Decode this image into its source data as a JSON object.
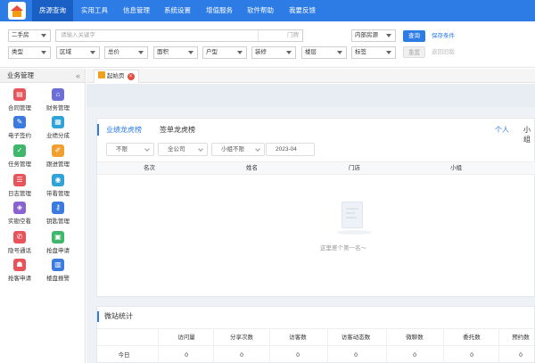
{
  "nav": {
    "items": [
      "房源查询",
      "实用工具",
      "信息管理",
      "系统设置",
      "增值服务",
      "软件帮助",
      "我要反馈"
    ],
    "active_index": 0
  },
  "search": {
    "type_select": "二手房",
    "keyword_placeholder": "请输入关键字",
    "store_label": "门牌",
    "scope_select": "内部房源",
    "query_button": "查询",
    "save_condition": "保存条件",
    "reset_button": "重置",
    "return_old": "返回旧版",
    "filters": [
      "类型",
      "区域",
      "总价",
      "面积",
      "户型",
      "装修",
      "楼层",
      "标签"
    ]
  },
  "sidebar": {
    "title": "业务管理",
    "collapse_icon": "double-chevron-left-icon",
    "items": [
      {
        "label": "合同管理",
        "icon": "contract-icon",
        "color": "#e9545a"
      },
      {
        "label": "财务管理",
        "icon": "finance-house-icon",
        "color": "#6b6fd6"
      },
      {
        "label": "电子签约",
        "icon": "e-sign-icon",
        "color": "#3b7be0"
      },
      {
        "label": "业绩分成",
        "icon": "performance-icon",
        "color": "#2fa3d7"
      },
      {
        "label": "任务管理",
        "icon": "task-icon",
        "color": "#3fb86b"
      },
      {
        "label": "跟进管理",
        "icon": "follow-icon",
        "color": "#f0a030"
      },
      {
        "label": "日志管理",
        "icon": "log-icon",
        "color": "#e9545a"
      },
      {
        "label": "带看管理",
        "icon": "eye-icon",
        "color": "#2fa3d7"
      },
      {
        "label": "实勘空看",
        "icon": "survey-icon",
        "color": "#8a63d2"
      },
      {
        "label": "钥匙管理",
        "icon": "key-icon",
        "color": "#3b7be0"
      },
      {
        "label": "隐号通话",
        "icon": "phone-icon",
        "color": "#e9545a"
      },
      {
        "label": "抢盘申请",
        "icon": "grab-icon",
        "color": "#3fb86b"
      },
      {
        "label": "抢客申请",
        "icon": "grab-client-icon",
        "color": "#e9545a"
      },
      {
        "label": "楼盘报警",
        "icon": "building-alert-icon",
        "color": "#3b7be0"
      }
    ]
  },
  "tabs": {
    "home": "起始页"
  },
  "ranking": {
    "tab_performance": "业绩龙虎榜",
    "tab_signing": "签单龙虎榜",
    "scope_personal": "个人",
    "scope_group": "小组",
    "filter_period": "不限",
    "filter_company": "全公司",
    "filter_group": "小组不限",
    "filter_month": "2023-04",
    "columns": [
      "名次",
      "姓名",
      "门店",
      "小组"
    ],
    "empty_text": "这里差个第一名～"
  },
  "stats": {
    "title": "微站统计",
    "columns": [
      "访问量",
      "分享次数",
      "访客数",
      "访客动态数",
      "微聊数",
      "委托数",
      "预约数"
    ],
    "rows": [
      {
        "label": "今日",
        "values": [
          "0",
          "0",
          "0",
          "0",
          "0",
          "0",
          "0"
        ]
      }
    ]
  },
  "colors": {
    "nav_bg": "#2d7be5",
    "nav_active": "#1a5fc4",
    "accent": "#2d7be5"
  }
}
